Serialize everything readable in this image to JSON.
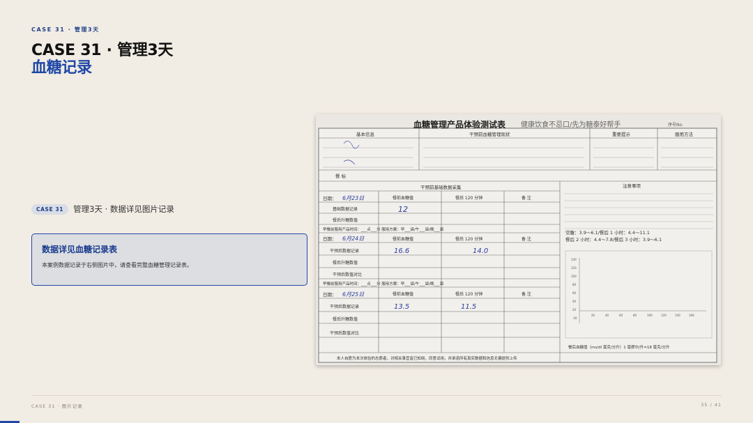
{
  "header": {
    "kicker": "CASE 31 · 管理3天",
    "title_line1": "CASE 31 · 管理3天",
    "title_line2": "血糖记录"
  },
  "tagline": {
    "pill": "CASE 31",
    "text": "管理3天 · 数据详见图片记录"
  },
  "card": {
    "title": "数据详见血糖记录表",
    "body": "本案例数据记录于右侧图片中，请查看完整血糖管理记录表。"
  },
  "photo": {
    "form_title": "血糖管理产品体验测试表",
    "slogan": "健康饮食不忌口/先为糖泰好帮手",
    "serial_label": "序号No.",
    "basic_info": "基本信息",
    "status_header": "干预前血糖管理现状",
    "notes_header": "重要提示",
    "method_header": "服用方法",
    "meal": "餐    标",
    "baseline_header": "干预前基础数据采集",
    "notes_title": "注意事项",
    "date_label": "日期：",
    "pre_meal": "餐前血糖值",
    "post_meal": "餐后 120 分钟",
    "remarks": "备    注",
    "row_base": "基础数据记录",
    "row_rise": "餐后升糖数值",
    "row_intervene": "干预后干预数据采集",
    "row_after": "干预后数据记录",
    "row_compare": "干预后数值对比",
    "time_line": "早餐前服用产品时间：___点___分  服用方案：早___袋/午___袋/晚___袋",
    "reference": "空腹：3.9～6.1/餐后 1 小时：4.4～11.1",
    "reference2": "餐后 2 小时：4.4～7.8/餐后 3 小时：3.9～6.1",
    "unit_note": "餐后血糖值（ms/dl 毫克/分升）1 毫摩尔/升=18 毫克/分升",
    "footer_note": "本人自愿为本次体验的志愿者，对相关事宜皆已知晓，同意试用，并承诺所有真实数据和信息无偏提供上传",
    "hw_day1_pre": "12",
    "hw_day2_pre": "16.6",
    "hw_day2_post": "14.0",
    "hw_day3_pre": "13.5",
    "hw_day3_post": "11.5",
    "hw_date1": "6月23日",
    "hw_date2": "6月24日",
    "hw_date3": "6月25日"
  },
  "footer": {
    "left": "CASE 31 · 图片记录",
    "right": "35 / 41"
  },
  "colors": {
    "accent": "#1f47a6",
    "background": "#f1ece4"
  }
}
